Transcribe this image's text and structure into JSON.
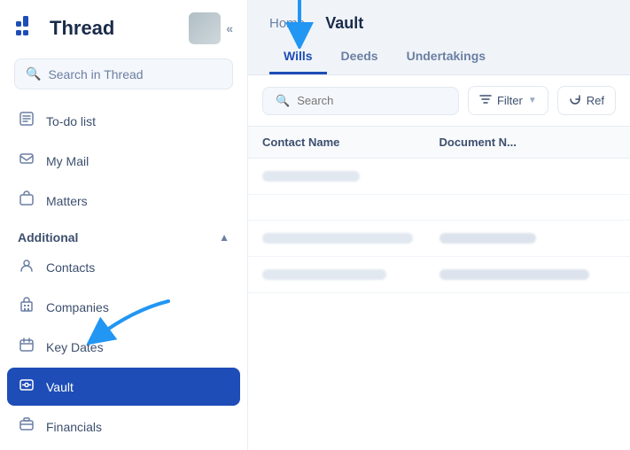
{
  "sidebar": {
    "logo_text": "Thread",
    "search_placeholder": "Search in Thread",
    "collapse_icon": "«",
    "nav_items": [
      {
        "id": "todo",
        "label": "To-do list",
        "icon": "📋"
      },
      {
        "id": "mymail",
        "label": "My Mail",
        "icon": "📧"
      },
      {
        "id": "matters",
        "label": "Matters",
        "icon": "💼"
      }
    ],
    "section_label": "Additional",
    "additional_items": [
      {
        "id": "contacts",
        "label": "Contacts",
        "icon": "👤"
      },
      {
        "id": "companies",
        "label": "Companies",
        "icon": "🏢"
      },
      {
        "id": "keydates",
        "label": "Key Dates",
        "icon": "📅"
      },
      {
        "id": "vault",
        "label": "Vault",
        "icon": "🗄️",
        "active": true
      },
      {
        "id": "financials",
        "label": "Financials",
        "icon": "💰"
      }
    ]
  },
  "header": {
    "breadcrumb_home": "Home",
    "breadcrumb_current": "Vault",
    "tabs": [
      {
        "id": "wills",
        "label": "Wills",
        "active": true
      },
      {
        "id": "deeds",
        "label": "Deeds",
        "active": false
      },
      {
        "id": "undertakings",
        "label": "Undertakings",
        "active": false
      }
    ]
  },
  "toolbar": {
    "search_placeholder": "Search",
    "filter_label": "Filter",
    "refresh_label": "Ref"
  },
  "table": {
    "columns": [
      {
        "id": "contact_name",
        "label": "Contact Name"
      },
      {
        "id": "document",
        "label": "Document N..."
      }
    ],
    "rows": [
      {
        "contact": "",
        "document": ""
      },
      {
        "contact": "",
        "document": ""
      },
      {
        "contact": "",
        "document": ""
      },
      {
        "contact": "",
        "document": ""
      }
    ]
  },
  "annotation_arrow_color": "#2196f3"
}
